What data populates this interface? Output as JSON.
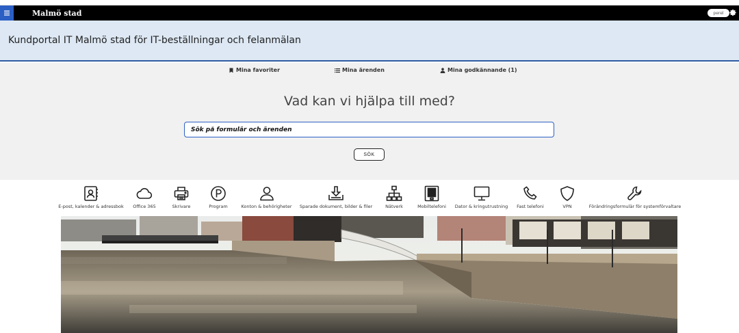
{
  "topbar": {
    "brand": "Malmö stad",
    "user_label": "perel"
  },
  "header": {
    "title": "Kundportal IT Malmö stad för IT-beställningar och felanmälan"
  },
  "quicklinks": {
    "favorites": "Mina favoriter",
    "cases": "Mina ärenden",
    "approvals": "Mina godkännande (1)"
  },
  "search": {
    "headline": "Vad kan vi hjälpa till med?",
    "placeholder": "Sök på formulär och ärenden",
    "button_label": "SÖK"
  },
  "categories": [
    {
      "label": "E-post, kalender & adressbok",
      "icon": "contact-book-icon"
    },
    {
      "label": "Office 365",
      "icon": "cloud-icon"
    },
    {
      "label": "Skrivare",
      "icon": "printer-icon"
    },
    {
      "label": "Program",
      "icon": "program-p-icon"
    },
    {
      "label": "Konton & behörigheter",
      "icon": "user-icon"
    },
    {
      "label": "Sparade dokument, bilder & filer",
      "icon": "download-tray-icon"
    },
    {
      "label": "Nätverk",
      "icon": "network-icon"
    },
    {
      "label": "Mobiltelefoni",
      "icon": "mobile-phone-icon"
    },
    {
      "label": "Dator & kringutrustning",
      "icon": "monitor-icon"
    },
    {
      "label": "Fast telefoni",
      "icon": "phone-handset-icon"
    },
    {
      "label": "VPN",
      "icon": "shield-icon"
    },
    {
      "label": "Förändringsformulär för systemförvaltare",
      "icon": "wrench-icon"
    }
  ],
  "colors": {
    "accent": "#2b5fc4",
    "title_band": "#dde8f4",
    "search_area": "#f1f1f1"
  }
}
